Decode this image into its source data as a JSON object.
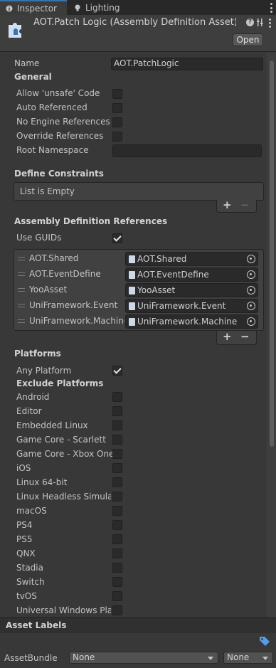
{
  "tabs": [
    {
      "label": "Inspector",
      "icon": "info-icon",
      "active": true
    },
    {
      "label": "Lighting",
      "icon": "bulb-icon",
      "active": false
    }
  ],
  "header": {
    "title": "AOT.Patch Logic (Assembly Definition Asset) Ir",
    "open_label": "Open",
    "icon": "assembly-definition-icon"
  },
  "name_field": {
    "label": "Name",
    "value": "AOT.PatchLogic"
  },
  "general": {
    "title": "General",
    "options": [
      {
        "label": "Allow 'unsafe' Code",
        "checked": false
      },
      {
        "label": "Auto Referenced",
        "checked": false
      },
      {
        "label": "No Engine References",
        "checked": false
      },
      {
        "label": "Override References",
        "checked": false
      }
    ],
    "root_namespace_label": "Root Namespace",
    "root_namespace_value": ""
  },
  "define_constraints": {
    "title": "Define Constraints",
    "empty_text": "List is Empty",
    "add": "+",
    "remove": "−"
  },
  "references": {
    "title": "Assembly Definition References",
    "use_guids_label": "Use GUIDs",
    "use_guids_checked": true,
    "items": [
      {
        "label": "AOT.Shared",
        "value": "AOT.Shared"
      },
      {
        "label": "AOT.EventDefine",
        "value": "AOT.EventDefine"
      },
      {
        "label": "YooAsset",
        "value": "YooAsset"
      },
      {
        "label": "UniFramework.Event",
        "value": "UniFramework.Event"
      },
      {
        "label": "UniFramework.Machine",
        "value": "UniFramework.Machine"
      }
    ],
    "add": "+",
    "remove": "−"
  },
  "platforms": {
    "title": "Platforms",
    "any_platform_label": "Any Platform",
    "any_platform_checked": true,
    "exclude_title": "Exclude Platforms",
    "items": [
      {
        "label": "Android",
        "checked": false
      },
      {
        "label": "Editor",
        "checked": false
      },
      {
        "label": "Embedded Linux",
        "checked": false
      },
      {
        "label": "Game Core - Scarlett",
        "checked": false
      },
      {
        "label": "Game Core - Xbox One",
        "checked": false
      },
      {
        "label": "iOS",
        "checked": false
      },
      {
        "label": "Linux 64-bit",
        "checked": false
      },
      {
        "label": "Linux Headless Simulati",
        "checked": false
      },
      {
        "label": "macOS",
        "checked": false
      },
      {
        "label": "PS4",
        "checked": false
      },
      {
        "label": "PS5",
        "checked": false
      },
      {
        "label": "QNX",
        "checked": false
      },
      {
        "label": "Stadia",
        "checked": false
      },
      {
        "label": "Switch",
        "checked": false
      },
      {
        "label": "tvOS",
        "checked": false
      },
      {
        "label": "Universal Windows Plat",
        "checked": false
      }
    ]
  },
  "asset_labels": {
    "title": "Asset Labels",
    "assetbundle_label": "AssetBundle",
    "bundle_value": "None",
    "variant_value": "None"
  },
  "colors": {
    "accent": "#3a72b0",
    "background": "#383838",
    "field": "#2a2a2a"
  }
}
